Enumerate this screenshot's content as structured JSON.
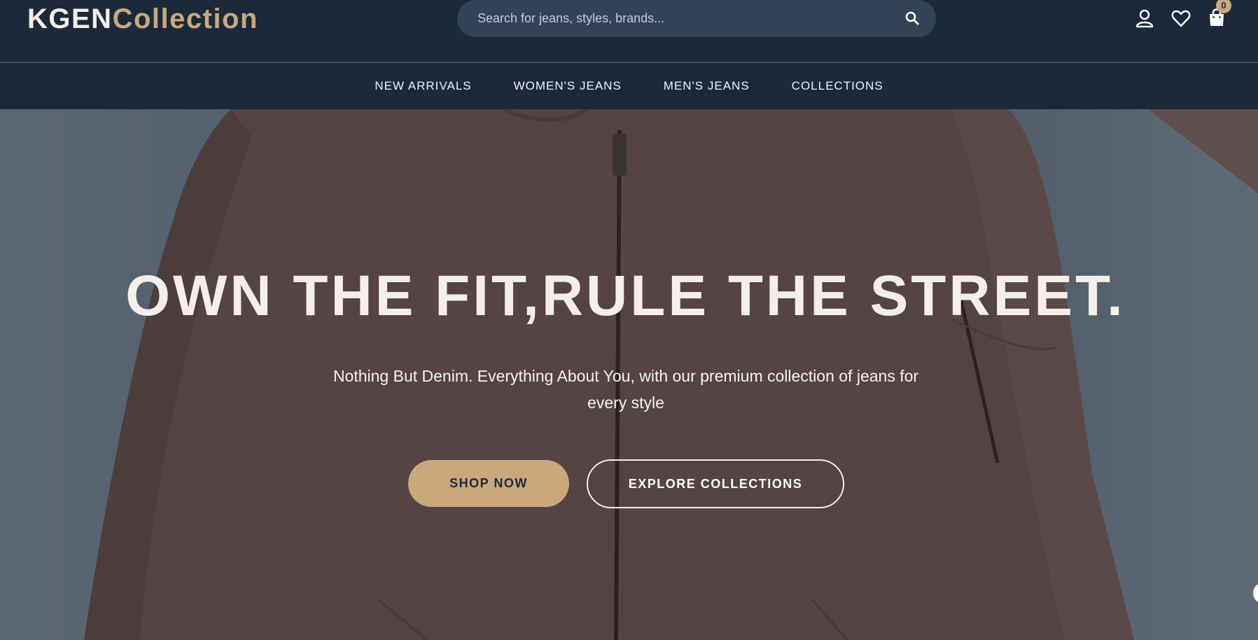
{
  "brand": {
    "part1": "KGEN",
    "part2": "Collection"
  },
  "search": {
    "placeholder": "Search for jeans, styles, brands..."
  },
  "header_icons": {
    "account": "user-icon",
    "wishlist": "heart-icon",
    "cart": "shopping-bag-icon",
    "cart_count": "0"
  },
  "nav": {
    "items": [
      {
        "label": "NEW ARRIVALS"
      },
      {
        "label": "WOMEN'S JEANS"
      },
      {
        "label": "MEN'S JEANS"
      },
      {
        "label": "COLLECTIONS"
      }
    ]
  },
  "hero": {
    "title": "OWN THE FIT,RULE THE STREET.",
    "subtitle": "Nothing But Denim. Everything About You, with our premium collection of jeans for every style",
    "primary_cta": "SHOP NOW",
    "secondary_cta": "EXPLORE COLLECTIONS"
  },
  "colors": {
    "header_bg": "#1b2a3b",
    "accent": "#c9a97c",
    "search_bg": "#334456",
    "hero_text": "#f4efe9"
  }
}
